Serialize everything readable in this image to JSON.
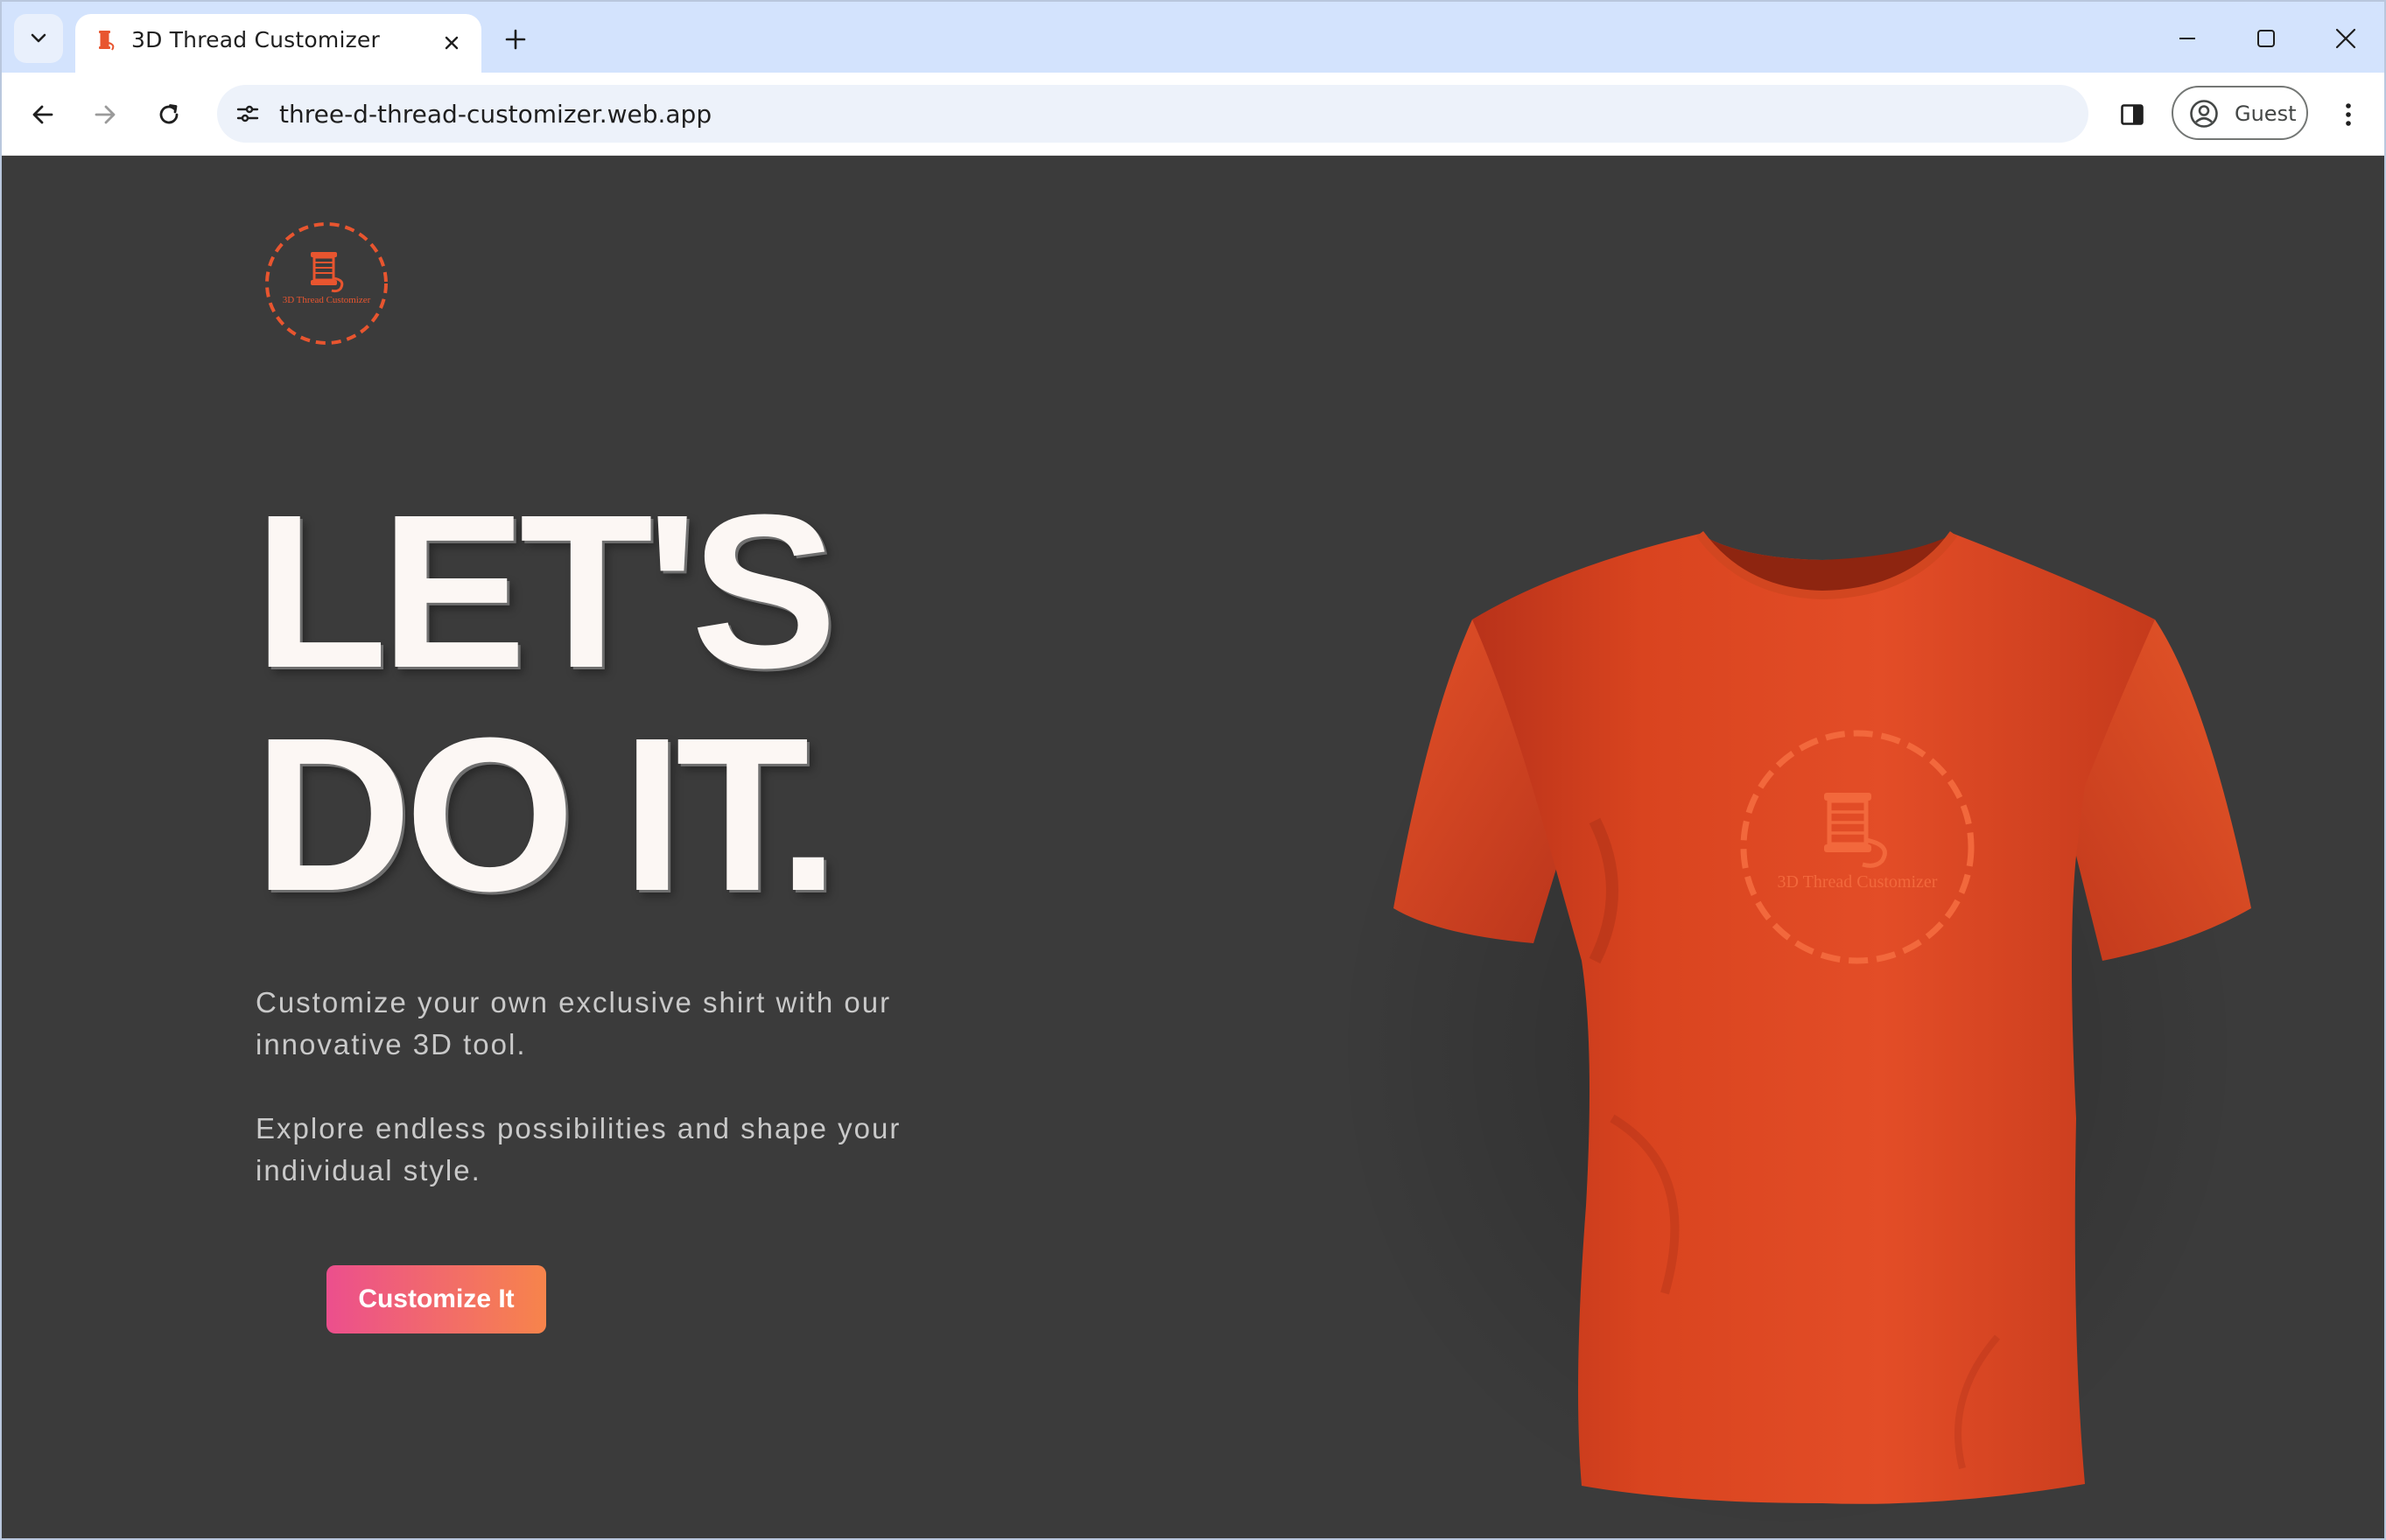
{
  "browser": {
    "tab": {
      "title": "3D Thread Customizer"
    },
    "address_bar": {
      "url": "three-d-thread-customizer.web.app"
    },
    "profile": {
      "label": "Guest"
    },
    "icons": {
      "tab_search": "chevron-down-icon",
      "tab_close": "close-icon",
      "new_tab": "plus-icon",
      "minimize": "minimize-icon",
      "maximize": "maximize-icon",
      "close_window": "close-icon",
      "back": "arrow-left-icon",
      "forward": "arrow-right-icon",
      "reload": "reload-icon",
      "site_info": "tune-icon",
      "side_panel": "side-panel-icon",
      "menu": "more-vertical-icon"
    }
  },
  "page": {
    "logo_text": "3D Thread Customizer",
    "hero": {
      "line1": "LET'S",
      "line2": "DO IT."
    },
    "description": [
      "Customize your own exclusive shirt with our innovative 3D tool.",
      "Explore endless possibilities and shape your individual style."
    ],
    "cta_label": "Customize It",
    "shirt_print_text": "3D Thread Customizer"
  },
  "colors": {
    "page_background": "#3b3b3b",
    "shirt": "#e04a2a",
    "accent_logo": "#e8552f",
    "cta_gradient_start": "#ec4f8d",
    "cta_gradient_end": "#f7844b",
    "browser_frame": "#d3e3fd"
  }
}
